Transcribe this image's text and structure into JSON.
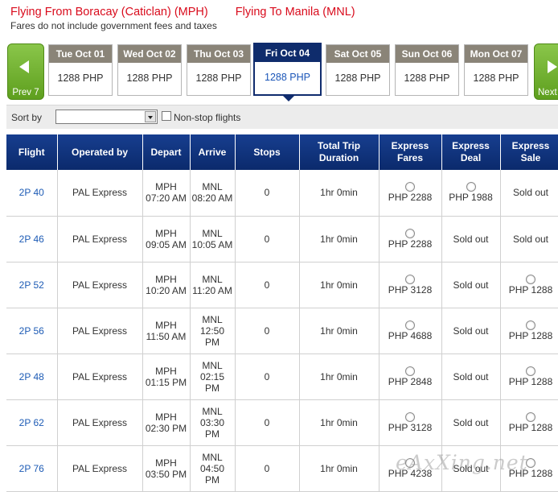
{
  "route": {
    "from": "Flying From Boracay (Caticlan) (MPH)",
    "to": "Flying To Manila (MNL)",
    "fare_note": "Fares do not include government fees and taxes"
  },
  "carousel": {
    "prev_label": "Prev 7",
    "next_label": "Next",
    "days": [
      {
        "label": "Tue Oct 01",
        "price": "1288 PHP",
        "selected": false
      },
      {
        "label": "Wed Oct 02",
        "price": "1288 PHP",
        "selected": false
      },
      {
        "label": "Thu Oct 03",
        "price": "1288 PHP",
        "selected": false
      },
      {
        "label": "Fri Oct 04",
        "price": "1288 PHP",
        "selected": true
      },
      {
        "label": "Sat Oct 05",
        "price": "1288 PHP",
        "selected": false
      },
      {
        "label": "Sun Oct 06",
        "price": "1288 PHP",
        "selected": false
      },
      {
        "label": "Mon Oct 07",
        "price": "1288 PHP",
        "selected": false
      }
    ]
  },
  "sort": {
    "label": "Sort by",
    "value": "",
    "nonstop_label": "Non-stop flights",
    "nonstop_checked": false
  },
  "table": {
    "headers": {
      "flight": "Flight",
      "operated": "Operated by",
      "depart": "Depart",
      "arrive": "Arrive",
      "stops": "Stops",
      "duration": "Total Trip Duration",
      "express_fares": "Express Fares",
      "express_deal": "Express Deal",
      "express_sale": "Express Sale"
    },
    "rows": [
      {
        "flight": "2P 40",
        "operated": "PAL Express",
        "dep_code": "MPH",
        "dep_time": "07:20 AM",
        "arr_code": "MNL",
        "arr_time": "08:20 AM",
        "stops": "0",
        "duration": "1hr 0min",
        "fare": "PHP 2288",
        "deal": "PHP 1988",
        "sale": "Sold out"
      },
      {
        "flight": "2P 46",
        "operated": "PAL Express",
        "dep_code": "MPH",
        "dep_time": "09:05 AM",
        "arr_code": "MNL",
        "arr_time": "10:05 AM",
        "stops": "0",
        "duration": "1hr 0min",
        "fare": "PHP 2288",
        "deal": "Sold out",
        "sale": "Sold out"
      },
      {
        "flight": "2P 52",
        "operated": "PAL Express",
        "dep_code": "MPH",
        "dep_time": "10:20 AM",
        "arr_code": "MNL",
        "arr_time": "11:20 AM",
        "stops": "0",
        "duration": "1hr 0min",
        "fare": "PHP 3128",
        "deal": "Sold out",
        "sale": "PHP 1288"
      },
      {
        "flight": "2P 56",
        "operated": "PAL Express",
        "dep_code": "MPH",
        "dep_time": "11:50 AM",
        "arr_code": "MNL",
        "arr_time": "12:50 PM",
        "stops": "0",
        "duration": "1hr 0min",
        "fare": "PHP 4688",
        "deal": "Sold out",
        "sale": "PHP 1288"
      },
      {
        "flight": "2P 48",
        "operated": "PAL Express",
        "dep_code": "MPH",
        "dep_time": "01:15 PM",
        "arr_code": "MNL",
        "arr_time": "02:15 PM",
        "stops": "0",
        "duration": "1hr 0min",
        "fare": "PHP 2848",
        "deal": "Sold out",
        "sale": "PHP 1288"
      },
      {
        "flight": "2P 62",
        "operated": "PAL Express",
        "dep_code": "MPH",
        "dep_time": "02:30 PM",
        "arr_code": "MNL",
        "arr_time": "03:30 PM",
        "stops": "0",
        "duration": "1hr 0min",
        "fare": "PHP 3128",
        "deal": "Sold out",
        "sale": "PHP 1288"
      },
      {
        "flight": "2P 76",
        "operated": "PAL Express",
        "dep_code": "MPH",
        "dep_time": "03:50 PM",
        "arr_code": "MNL",
        "arr_time": "04:50 PM",
        "stops": "0",
        "duration": "1hr 0min",
        "fare": "PHP 4238",
        "deal": "Sold out",
        "sale": "PHP 1288"
      }
    ]
  },
  "watermark": "eAxXing.net",
  "colors": {
    "route_red": "#d90b1c",
    "header_navy": "#0f2c6c",
    "nav_green": "#6fb12e",
    "link_blue": "#1d5bb5"
  }
}
